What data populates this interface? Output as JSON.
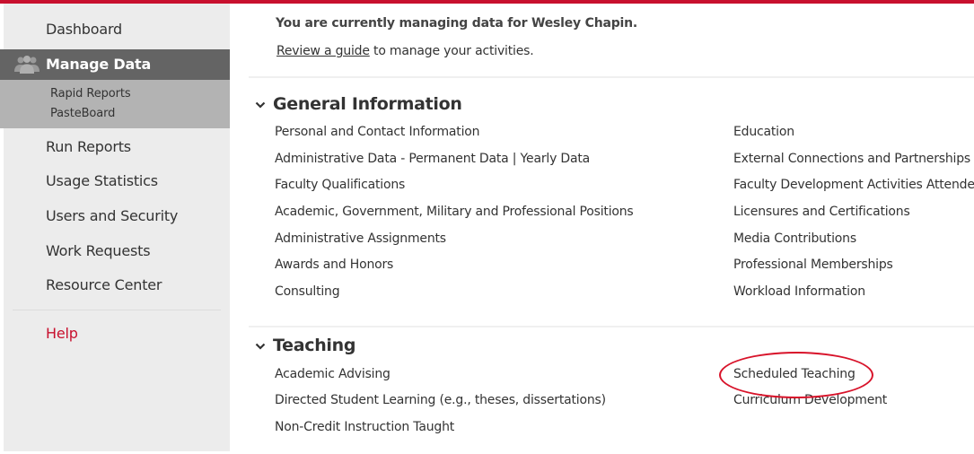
{
  "colors": {
    "brand": "#c8102e",
    "sidebar_bg": "#ececec",
    "active_bg": "#646464",
    "subnav_bg": "#b3b3b3",
    "annotation": "#d8132a"
  },
  "sidebar": {
    "items": [
      {
        "label": "Dashboard"
      },
      {
        "label": "Manage Data",
        "icon": "users-icon",
        "active": true
      },
      {
        "label": "Run Reports"
      },
      {
        "label": "Usage Statistics"
      },
      {
        "label": "Users and Security"
      },
      {
        "label": "Work Requests"
      },
      {
        "label": "Resource Center"
      }
    ],
    "subitems": [
      {
        "label": "Rapid Reports"
      },
      {
        "label": "PasteBoard"
      }
    ],
    "help": {
      "label": "Help"
    }
  },
  "main": {
    "intro": "You are currently managing data for Wesley Chapin.",
    "guide_link": "Review a guide",
    "guide_rest": " to manage your activities.",
    "sections": [
      {
        "title": "General Information",
        "icon": "chevron-down-icon",
        "left": [
          "Personal and Contact Information",
          "Administrative Data - Permanent Data | Yearly Data",
          "Faculty Qualifications",
          "Academic, Government, Military and Professional Positions",
          "Administrative Assignments",
          "Awards and Honors",
          "Consulting"
        ],
        "right": [
          "Education",
          "External Connections and Partnerships",
          "Faculty Development Activities Attended",
          "Licensures and Certifications",
          "Media Contributions",
          "Professional Memberships",
          "Workload Information"
        ]
      },
      {
        "title": "Teaching",
        "icon": "chevron-down-icon",
        "left": [
          "Academic Advising",
          "Directed Student Learning (e.g., theses, dissertations)",
          "Non-Credit Instruction Taught"
        ],
        "right": [
          "Scheduled Teaching",
          "Curriculum Development"
        ],
        "highlighted": "Scheduled Teaching"
      }
    ]
  }
}
